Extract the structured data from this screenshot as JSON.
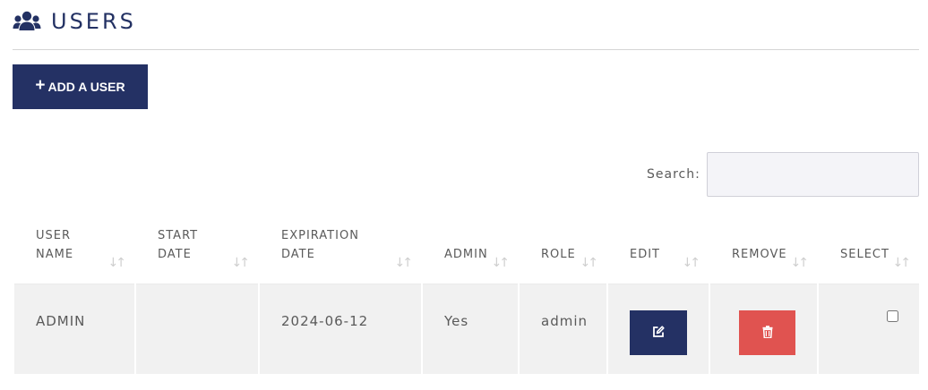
{
  "header": {
    "title": "USERS",
    "icon": "users-icon"
  },
  "toolbar": {
    "add_user_icon": "+",
    "add_user_label": "ADD A USER"
  },
  "search": {
    "label": "Search:",
    "value": "",
    "placeholder": ""
  },
  "table": {
    "columns": [
      {
        "line1": "USER",
        "line2": "NAME"
      },
      {
        "line1": "START",
        "line2": "DATE"
      },
      {
        "line1": "EXPIRATION",
        "line2": "DATE"
      },
      {
        "line1": "ADMIN",
        "line2": ""
      },
      {
        "line1": "ROLE",
        "line2": ""
      },
      {
        "line1": "EDIT",
        "line2": ""
      },
      {
        "line1": "REMOVE",
        "line2": ""
      },
      {
        "line1": "SELECT",
        "line2": ""
      }
    ],
    "sort_icon": "↓↑",
    "rows": [
      {
        "user_name": "ADMIN",
        "start_date": "",
        "expiration_date": "2024-06-12",
        "admin": "Yes",
        "role": "admin",
        "edit_icon": "edit-icon",
        "remove_icon": "trash-icon",
        "selected": false
      }
    ]
  },
  "colors": {
    "primary": "#243164",
    "danger": "#e05350",
    "row_background": "#f1f1f1",
    "search_background": "#f4f4f8"
  }
}
